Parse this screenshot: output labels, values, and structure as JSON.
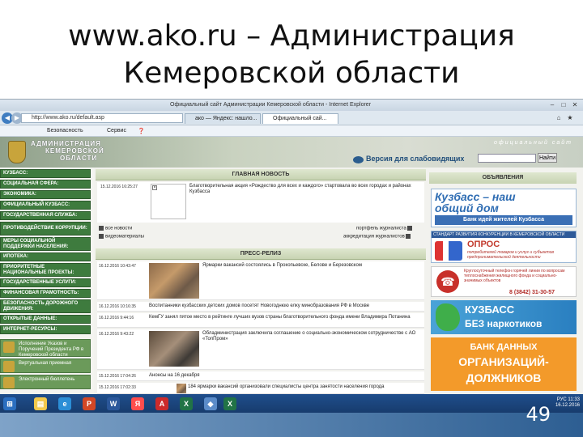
{
  "slide": {
    "title_line1": "www.ako.ru – Администрация",
    "title_line2": "Кемеровской области",
    "page_number": "49"
  },
  "browser": {
    "window_title": "Официальный сайт Администрации Кемеровской области - Internet Explorer",
    "url": "http://www.ako.ru/default.asp",
    "tabs": [
      {
        "label": "ако — Яндекс: нашло..."
      },
      {
        "label": "Официальный сай..."
      }
    ],
    "command_bar": {
      "security": "Безопасность",
      "service": "Сервис"
    }
  },
  "site": {
    "logo_line1": "АДМИНИСТРАЦИЯ",
    "logo_line2": "КЕМЕРОВСКОЙ",
    "logo_line3": "ОБЛАСТИ",
    "official_tag": "официальный сайт",
    "vision_link": "Версия для слабовидящих",
    "search_button": "Найти",
    "nav": [
      {
        "label": "КУЗБАСС:"
      },
      {
        "label": "СОЦИАЛЬНАЯ СФЕРА:"
      },
      {
        "label": "ЭКОНОМИКА:"
      },
      {
        "label": "ОФИЦИАЛЬНЫЙ КУЗБАСС:"
      },
      {
        "label": "ГОСУДАРСТВЕННАЯ СЛУЖБА:"
      },
      {
        "label": "ПРОТИВОДЕЙСТВИЕ КОРРУПЦИИ:"
      },
      {
        "label": "МЕРЫ СОЦИАЛЬНОЙ ПОДДЕРЖКИ НАСЕЛЕНИЯ:"
      },
      {
        "label": "ИПОТЕКА:"
      },
      {
        "label": "ПРИОРИТЕТНЫЕ НАЦИОНАЛЬНЫЕ ПРОЕКТЫ:"
      },
      {
        "label": "ГОСУДАРСТВЕННЫЕ УСЛУГИ:"
      },
      {
        "label": "ФИНАНСОВАЯ ГРАМОТНОСТЬ:"
      },
      {
        "label": "БЕЗОПАСНОСТЬ ДОРОЖНОГО ДВИЖЕНИЯ:"
      },
      {
        "label": "ОТКРЫТЫЕ ДАННЫЕ:"
      },
      {
        "label": "ИНТЕРНЕТ-РЕСУРСЫ:"
      }
    ],
    "side_banners": [
      {
        "label": "Исполнение Указов и Поручений Президента РФ в Кемеровской области"
      },
      {
        "label": "Виртуальная приемная"
      },
      {
        "label": "Электронный бюллетень"
      }
    ],
    "main_news": {
      "heading": "ГЛАВНАЯ НОВОСТЬ",
      "date": "15.12.2016 16:25:27",
      "text": "Благотворительная акция «Рождество для всех и каждого» стартовала во всех городах и районах Кузбасса",
      "links": {
        "all_news": "все новости",
        "video": "видеоматериалы",
        "portfolio": "портфель журналиста",
        "accreditation": "аккредитация журналистов"
      }
    },
    "press": {
      "heading": "ПРЕСС-РЕЛИЗ",
      "items": [
        {
          "date": "16.12.2016 10:43:47",
          "text": "Ярмарки вакансий состоялись в Прокопьевске, Белове и Березовском"
        },
        {
          "date": "16.12.2016 10:16:35",
          "text": "Воспитанники кузбасских детских домов посетят Новогоднюю елку минобразования РФ в Москве"
        },
        {
          "date": "16.12.2016 9:44:16",
          "text": "КемГУ занял пятое место в рейтинге лучших вузов страны благотворительного фонда имени Владимира Потанина"
        },
        {
          "date": "16.12.2016 9:43:22",
          "text": "Обладминистрация заключила соглашение о социально-экономическом сотрудничестве с АО «ТопПром»"
        },
        {
          "date": "15.12.2016 17:04:26",
          "text": "Анонсы на 16 декабря"
        },
        {
          "date": "15.12.2016 17:02:33",
          "text": "184 ярмарки вакансий организовали специалисты центра занятости населения города"
        }
      ]
    },
    "announcements": {
      "heading": "ОБЪЯВЛЕНИЯ",
      "ad1_title": "Кузбасс – наш общий дом",
      "ad1_sub": "Банк идей жителей Кузбасса",
      "ad2_header": "СТАНДАРТ РАЗВИТИЯ КОНКУРЕНЦИИ В КЕМЕРОВСКОЙ ОБЛАСТИ",
      "ad2_title": "ОПРОС",
      "ad2_desc": "потребителей товаров и услуг и субъектов предпринимательской деятельности",
      "ad3_text": "Круглосуточный телефон горячей линии по вопросам теплоснабжения жилищного фонда и социально-значимых объектов",
      "ad3_phone": "8 (3842) 31-30-57",
      "ad4_line1": "КУЗБАСС",
      "ad4_line2": "БЕЗ наркотиков",
      "ad5_line1": "БАНК ДАННЫХ",
      "ad5_line2": "ОРГАНИЗАЦИЙ-",
      "ad5_line3": "ДОЛЖНИКОВ"
    }
  },
  "taskbar": {
    "lang": "РУС",
    "time": "11:33",
    "date": "16.12.2016"
  }
}
